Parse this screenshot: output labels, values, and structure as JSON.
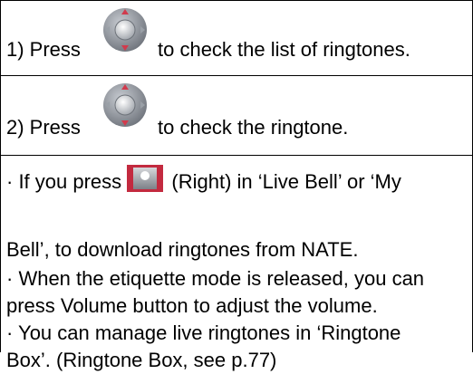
{
  "steps": [
    {
      "prefix": "1) Press",
      "suffix": "to check the list of ringtones.",
      "icon": "nav-key-up-down-icon"
    },
    {
      "prefix": "2) Press",
      "suffix": "to check the ringtone.",
      "icon": "nav-key-up-down-icon"
    }
  ],
  "notes": {
    "note1_before": "· If you press",
    "note1_after": "(Right) in ‘Live Bell’ or ‘My",
    "note1_line2": "Bell’, to download ringtones from NATE.",
    "note2_line1": "· When the etiquette mode is released, you can",
    "note2_line2": "press Volume button to adjust the volume.",
    "note3_line1": "· You can manage live ringtones in ‘Ringtone",
    "note3_line2": "Box’. (Ringtone Box, see p.77)",
    "right_key_icon": "right-key-icon"
  },
  "colors": {
    "key_outer": "#8a8f97",
    "key_arrow": "#d13b4d",
    "key_center": "#d9dce1"
  }
}
